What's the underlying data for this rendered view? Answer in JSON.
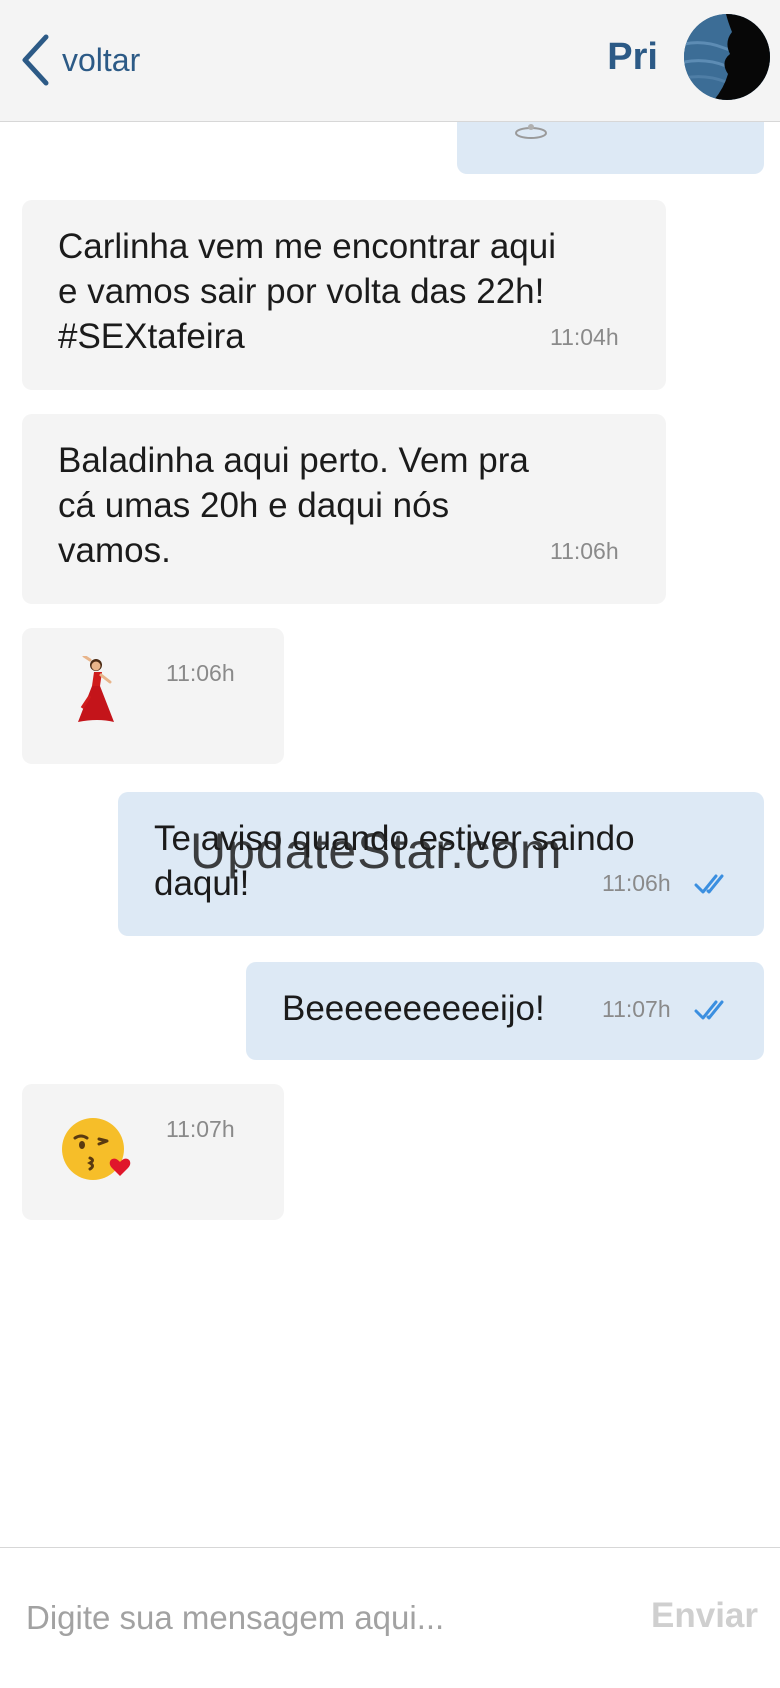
{
  "header": {
    "back_label": "voltar",
    "contact_name": "Pri"
  },
  "messages": [
    {
      "direction": "outgoing",
      "type": "image-partial"
    },
    {
      "direction": "incoming",
      "lines": [
        "Carlinha vem me encontrar aqui",
        "e vamos sair por volta das 22h!",
        "#SEXtafeira"
      ],
      "time": "11:04h"
    },
    {
      "direction": "incoming",
      "lines": [
        "Baladinha aqui perto. Vem pra",
        "cá umas 20h e daqui nós",
        "vamos."
      ],
      "time": "11:06h"
    },
    {
      "direction": "incoming",
      "emoji": "dancer-emoji",
      "time": "11:06h"
    },
    {
      "direction": "outgoing",
      "lines": [
        "Te aviso quando estiver saindo",
        "daqui!"
      ],
      "time": "11:06h",
      "status": "read"
    },
    {
      "direction": "outgoing",
      "lines": [
        "Beeeeeeeeeeijo!"
      ],
      "time": "11:07h",
      "status": "read"
    },
    {
      "direction": "incoming",
      "emoji": "kiss-emoji",
      "time": "11:07h"
    }
  ],
  "watermark": "UpdateStar.com",
  "composer": {
    "placeholder": "Digite sua mensagem aqui...",
    "send_label": "Enviar"
  },
  "colors": {
    "accent": "#2c5a86",
    "incoming_bubble": "#f4f4f4",
    "outgoing_bubble": "#dde9f5",
    "read_ticks": "#3b8fe0"
  }
}
